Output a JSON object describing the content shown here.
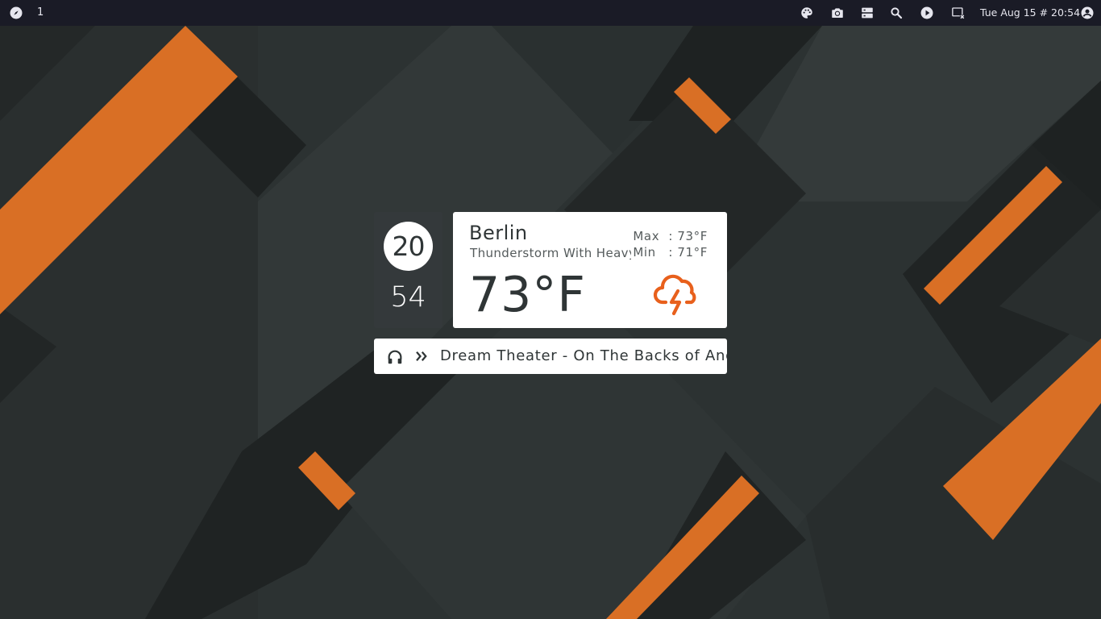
{
  "topbar": {
    "workspace": "1",
    "clock": "Tue Aug 15 # 20:54",
    "icons": [
      "compass-icon",
      "palette-icon",
      "camera-icon",
      "server-icon",
      "search-icon",
      "play-circle-icon",
      "screen-close-icon",
      "account-icon"
    ]
  },
  "clock_widget": {
    "hour": "20",
    "minute": "54"
  },
  "weather": {
    "city": "Berlin",
    "condition": "Thunderstorm With Heavy",
    "max_label": "Max",
    "max_value": ": 73°F",
    "min_label": "Min",
    "min_value": ": 71°F",
    "temperature": "73°F",
    "icon": "thunderstorm-cloud-icon"
  },
  "music": {
    "track": "Dream Theater - On The Backs of Angels"
  },
  "colors": {
    "accent": "#d96f25",
    "topbar": "#1a1b26",
    "panel_dark": "#343a3c",
    "text_dark": "#2f3536"
  }
}
